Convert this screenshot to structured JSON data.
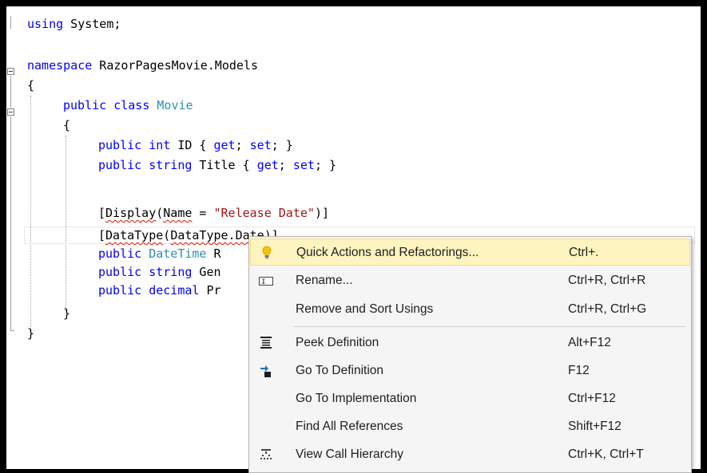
{
  "code": {
    "l1": {
      "kw": "using",
      "rest": " System;"
    },
    "l2": {
      "kw": "namespace",
      "rest": " RazorPagesMovie.Models"
    },
    "l3": {
      "text": "{"
    },
    "l4": {
      "kw1": "public",
      "kw2": "class",
      "ty": "Movie"
    },
    "l5": {
      "text": "{"
    },
    "l6": {
      "kw1": "public",
      "kw2": "int",
      "name": " ID { ",
      "get": "get",
      "semi": "; ",
      "set": "set",
      "end": "; }"
    },
    "l7": {
      "kw1": "public",
      "kw2": "string",
      "name": " Title { ",
      "get": "get",
      "semi": "; ",
      "set": "set",
      "end": "; }"
    },
    "l8": {
      "open": "[",
      "attr": "Display",
      "paren": "(",
      "named": "Name",
      "eq": " = ",
      "str": "\"Release Date\"",
      "close": ")]"
    },
    "l9": {
      "open": "[",
      "attr": "DataType",
      "paren": "(",
      "arg": "DataType.Date",
      "close": ")]"
    },
    "l10": {
      "kw": "public",
      "ty": "DateTime",
      "rest": " R"
    },
    "l11": {
      "kw1": "public",
      "kw2": "string",
      "rest": " Gen"
    },
    "l12": {
      "kw1": "public",
      "kw2": "decimal",
      "rest": " Pr"
    },
    "l13": {
      "text": "}"
    },
    "l14": {
      "text": "}"
    }
  },
  "context_menu": {
    "items": [
      {
        "label": "Quick Actions and Refactorings...",
        "shortcut": "Ctrl+.",
        "icon": "lightbulb-icon",
        "highlighted": true
      },
      {
        "label": "Rename...",
        "shortcut": "Ctrl+R, Ctrl+R",
        "icon": "rename-icon"
      },
      {
        "label": "Remove and Sort Usings",
        "shortcut": "Ctrl+R, Ctrl+G",
        "icon": ""
      },
      {
        "label": "Peek Definition",
        "shortcut": "Alt+F12",
        "icon": "peek-definition-icon"
      },
      {
        "label": "Go To Definition",
        "shortcut": "F12",
        "icon": "go-to-definition-icon"
      },
      {
        "label": "Go To Implementation",
        "shortcut": "Ctrl+F12",
        "icon": ""
      },
      {
        "label": "Find All References",
        "shortcut": "Shift+F12",
        "icon": ""
      },
      {
        "label": "View Call Hierarchy",
        "shortcut": "Ctrl+K, Ctrl+T",
        "icon": "call-hierarchy-icon"
      }
    ]
  },
  "colors": {
    "keyword": "#0000ff",
    "type": "#2b91af",
    "string": "#a31515",
    "highlight": "#fdf4bf",
    "menu_bg": "#f5f5f5"
  }
}
